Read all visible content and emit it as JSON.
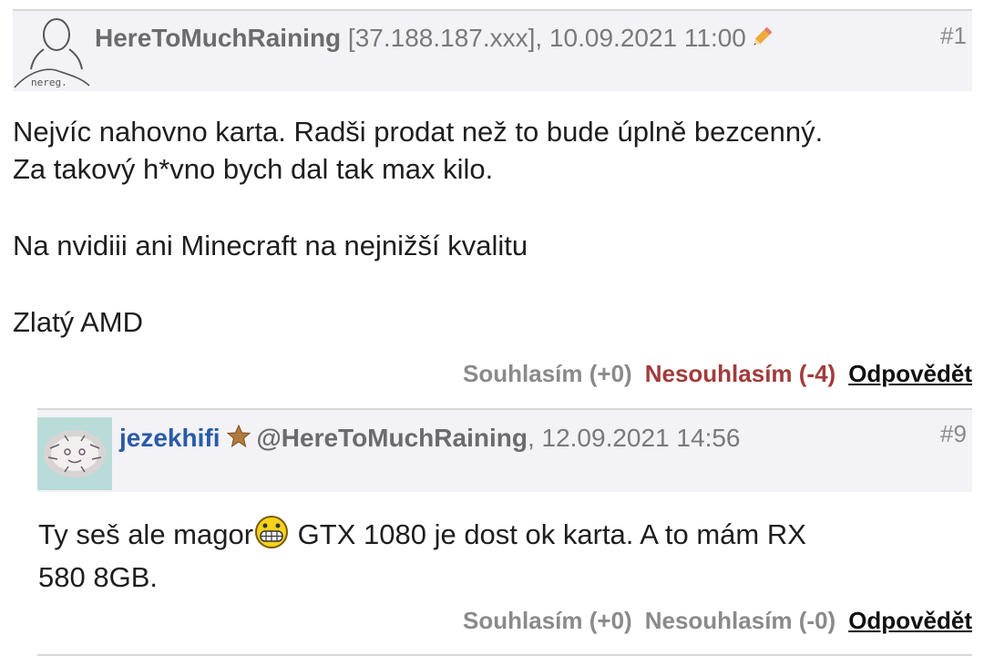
{
  "posts": [
    {
      "author": "HereToMuchRaining",
      "meta": " [37.188.187.xxx], 10.09.2021 11:00",
      "number": "#1",
      "avatar_label": "nereg.",
      "avatar_icon": "anonymous-user-icon",
      "edit_icon": "pencil-icon",
      "lines": [
        "Nejvíc nahovno karta. Radši prodat než to bude úplně bezcenný.",
        "Za takový h*vno bych dal tak max kilo.",
        "Na nvidiii ani Minecraft na nejnižší kvalitu",
        "Zlatý AMD"
      ],
      "agree": "Souhlasím (+0)",
      "disagree": "Nesouhlasím (-4)",
      "reply": "Odpovědět"
    },
    {
      "author": "jezekhifi",
      "mention": "@HereToMuchRaining",
      "meta": ", 12.09.2021 14:56",
      "number": "#9",
      "badge_icon": "star-badge-icon",
      "text_before": "Ty seš ale magor",
      "smiley_icon": "grinning-smiley-icon",
      "text_after": " GTX 1080 je dost ok karta. A to mám RX",
      "text_line2": "580 8GB.",
      "agree": "Souhlasím (+0)",
      "disagree": "Nesouhlasím (-0)",
      "reply": "Odpovědět"
    }
  ],
  "colors": {
    "header_bg": "#f2f2f7",
    "disagree_negative": "#a33a3a",
    "reply_author": "#2a5aa8",
    "reply_avatar_bg": "#b9dcd9"
  }
}
